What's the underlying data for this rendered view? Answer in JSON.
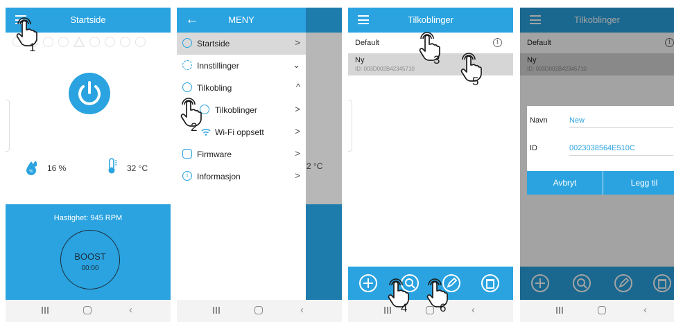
{
  "screens": {
    "home": {
      "title": "Startside",
      "humidity": "16 %",
      "temperature": "32 °C",
      "speed": "Hastighet: 945 RPM",
      "boost_label": "BOOST",
      "boost_time": "00:00"
    },
    "menu": {
      "title": "MENY",
      "items": [
        {
          "label": "Startside",
          "chevron": ">"
        },
        {
          "label": "Innstillinger",
          "chevron": "⌄"
        },
        {
          "label": "Tilkobling",
          "chevron": "^"
        },
        {
          "label": "Tilkoblinger",
          "chevron": ">"
        },
        {
          "label": "Wi-Fi oppsett",
          "chevron": ">"
        },
        {
          "label": "Firmware",
          "chevron": ">"
        },
        {
          "label": "Informasjon",
          "chevron": ">"
        }
      ],
      "overlay_temp": "2 °C"
    },
    "connections": {
      "title": "Tilkoblinger",
      "rows": [
        {
          "name": "Default",
          "id": ""
        },
        {
          "name": "Ny",
          "id": "ID: 003D002B42345710"
        }
      ]
    },
    "dialog_screen": {
      "title": "Tilkoblinger",
      "rows": [
        {
          "name": "Default"
        },
        {
          "name": "Ny",
          "id": "ID: 003D002B42345710"
        }
      ],
      "dialog": {
        "name_label": "Navn",
        "name_value": "New",
        "id_label": "ID",
        "id_value": "0023038564E510C",
        "cancel_label": "Avbryt",
        "add_label": "Legg til"
      }
    }
  },
  "step_markers": [
    "1",
    "2",
    "3",
    "4",
    "5",
    "6"
  ],
  "colors": {
    "accent": "#2aa3e0",
    "dark_accent": "#1e7cad",
    "menu_active": "#d9d9d9",
    "gesture_stroke": "#1b1b1b"
  },
  "icons": [
    "hamburger-icon",
    "power-icon",
    "humidity-icon",
    "thermometer-icon",
    "back-arrow-icon",
    "home-icon",
    "settings-icon",
    "share-icon",
    "list-icon",
    "wifi-icon",
    "chip-icon",
    "info-icon",
    "add-icon",
    "search-icon",
    "edit-icon",
    "trash-icon",
    "tap-gesture-icon"
  ]
}
